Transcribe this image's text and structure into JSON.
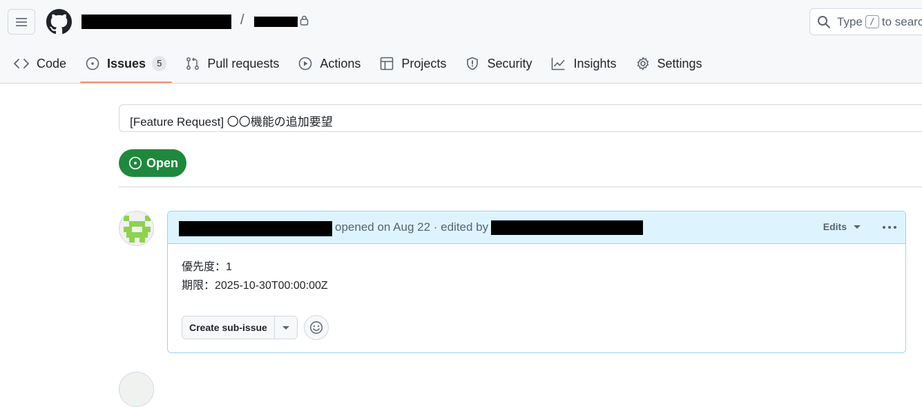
{
  "header": {
    "separator": "/",
    "search_placeholder_prefix": "Type",
    "search_key": "/",
    "search_placeholder_suffix": "to search"
  },
  "tabs": [
    {
      "label": "Code",
      "icon": "code-icon"
    },
    {
      "label": "Issues",
      "icon": "issue-opened-icon",
      "counter": "5",
      "active": true
    },
    {
      "label": "Pull requests",
      "icon": "git-pull-request-icon"
    },
    {
      "label": "Actions",
      "icon": "play-icon"
    },
    {
      "label": "Projects",
      "icon": "table-icon"
    },
    {
      "label": "Security",
      "icon": "shield-icon"
    },
    {
      "label": "Insights",
      "icon": "graph-icon"
    },
    {
      "label": "Settings",
      "icon": "gear-icon"
    }
  ],
  "issue": {
    "title": "[Feature Request] 〇〇機能の追加要望",
    "state": "Open",
    "comment": {
      "meta": "opened on Aug 22 · edited by",
      "edits_label": "Edits",
      "body_line1": "優先度：1",
      "body_line2": "期限：2025-10-30T00:00:00Z",
      "create_subissue_label": "Create sub-issue"
    }
  },
  "colors": {
    "open_green": "#1f883d",
    "active_tab_underline": "#fd8c73",
    "comment_header_bg": "#ddf4ff",
    "comment_border": "#9cd2f5"
  }
}
